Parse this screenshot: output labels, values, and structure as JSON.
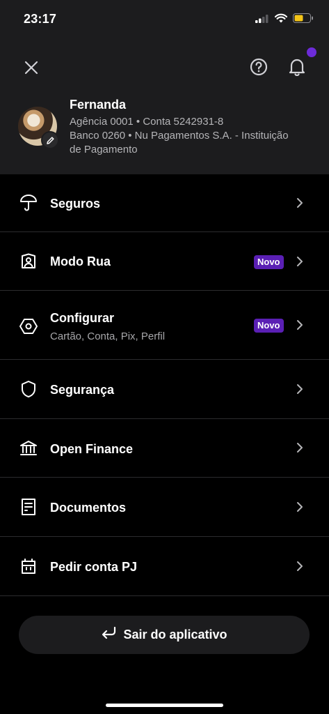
{
  "status_bar": {
    "time": "23:17"
  },
  "profile": {
    "name": "Fernanda",
    "line1": "Agência 0001 • Conta 5242931-8",
    "line2": "Banco 0260 • Nu Pagamentos S.A. - Instituição",
    "line3": "de Pagamento"
  },
  "menu": {
    "items": [
      {
        "label": "Seguros",
        "icon": "umbrella-icon"
      },
      {
        "label": "Modo Rua",
        "icon": "person-shield-icon",
        "badge": "Novo"
      },
      {
        "label": "Configurar",
        "subtitle": "Cartão, Conta, Pix, Perfil",
        "icon": "settings-hexagon-icon",
        "badge": "Novo"
      },
      {
        "label": "Segurança",
        "icon": "shield-icon"
      },
      {
        "label": "Open Finance",
        "icon": "bank-icon"
      },
      {
        "label": "Documentos",
        "icon": "document-icon"
      },
      {
        "label": "Pedir conta PJ",
        "icon": "building-icon"
      }
    ]
  },
  "logout": {
    "label": "Sair do aplicativo",
    "icon": "return-arrow-icon"
  },
  "colors": {
    "badge": "#5a1fb4",
    "notification_dot": "#6c2bd9",
    "header_bg": "#1c1c1e",
    "page_bg": "#000000"
  }
}
